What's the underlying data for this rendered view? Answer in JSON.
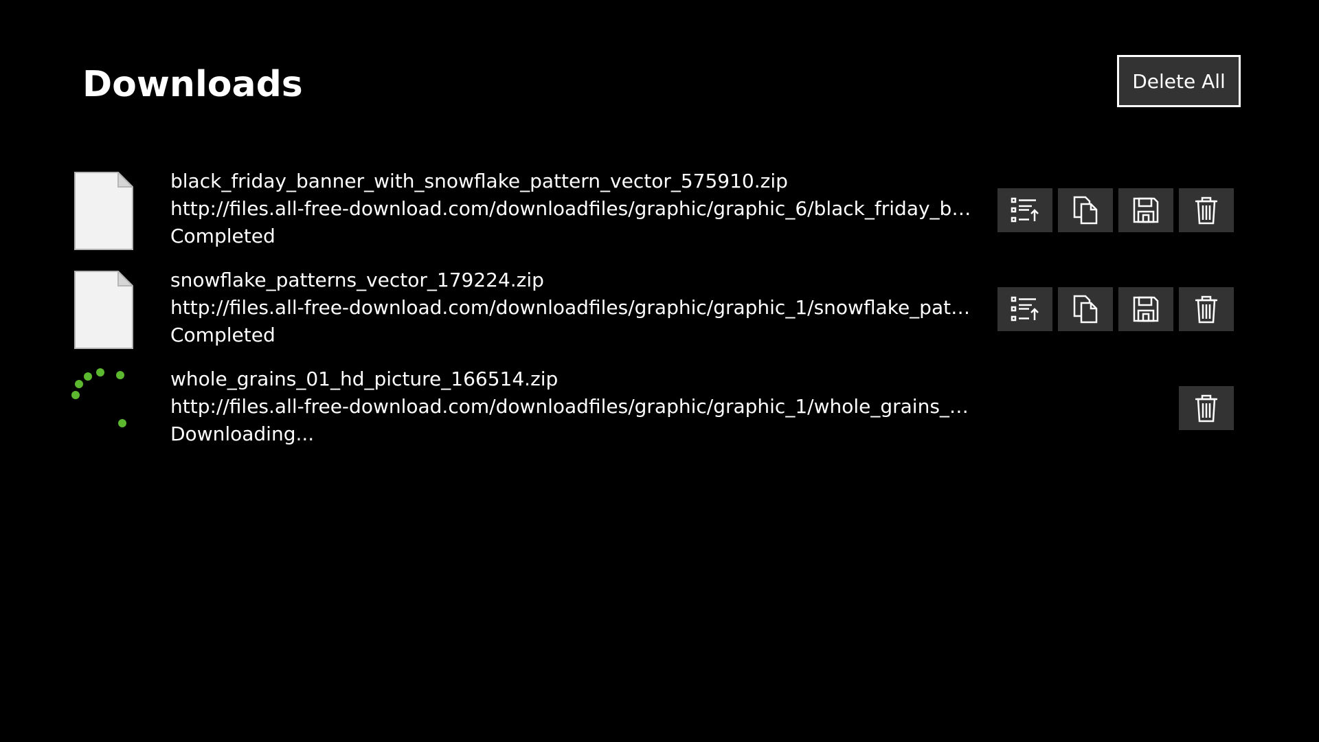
{
  "header": {
    "title": "Downloads",
    "delete_all_label": "Delete All"
  },
  "downloads": [
    {
      "filename": "black_friday_banner_with_snowflake_pattern_vector_575910.zip",
      "url": "http://files.all-free-download.com/downloadfiles/graphic/graphic_6/black_friday_bann...",
      "status": "Completed",
      "icon": "file-icon",
      "actions": [
        "open-folder-icon",
        "copy-icon",
        "save-icon",
        "delete-icon"
      ]
    },
    {
      "filename": "snowflake_patterns_vector_179224.zip",
      "url": "http://files.all-free-download.com/downloadfiles/graphic/graphic_1/snowflake_pattern...",
      "status": "Completed",
      "icon": "file-icon",
      "actions": [
        "open-folder-icon",
        "copy-icon",
        "save-icon",
        "delete-icon"
      ]
    },
    {
      "filename": "whole_grains_01_hd_picture_166514.zip",
      "url": "http://files.all-free-download.com/downloadfiles/graphic/graphic_1/whole_grains_01_...",
      "status": "Downloading...",
      "icon": "loading-spinner-icon",
      "actions": [
        "delete-icon"
      ]
    }
  ],
  "colors": {
    "background": "#000000",
    "text": "#ffffff",
    "button_bg": "#333333",
    "spinner": "#5cb82e",
    "file_icon": "#f2f2f2"
  }
}
